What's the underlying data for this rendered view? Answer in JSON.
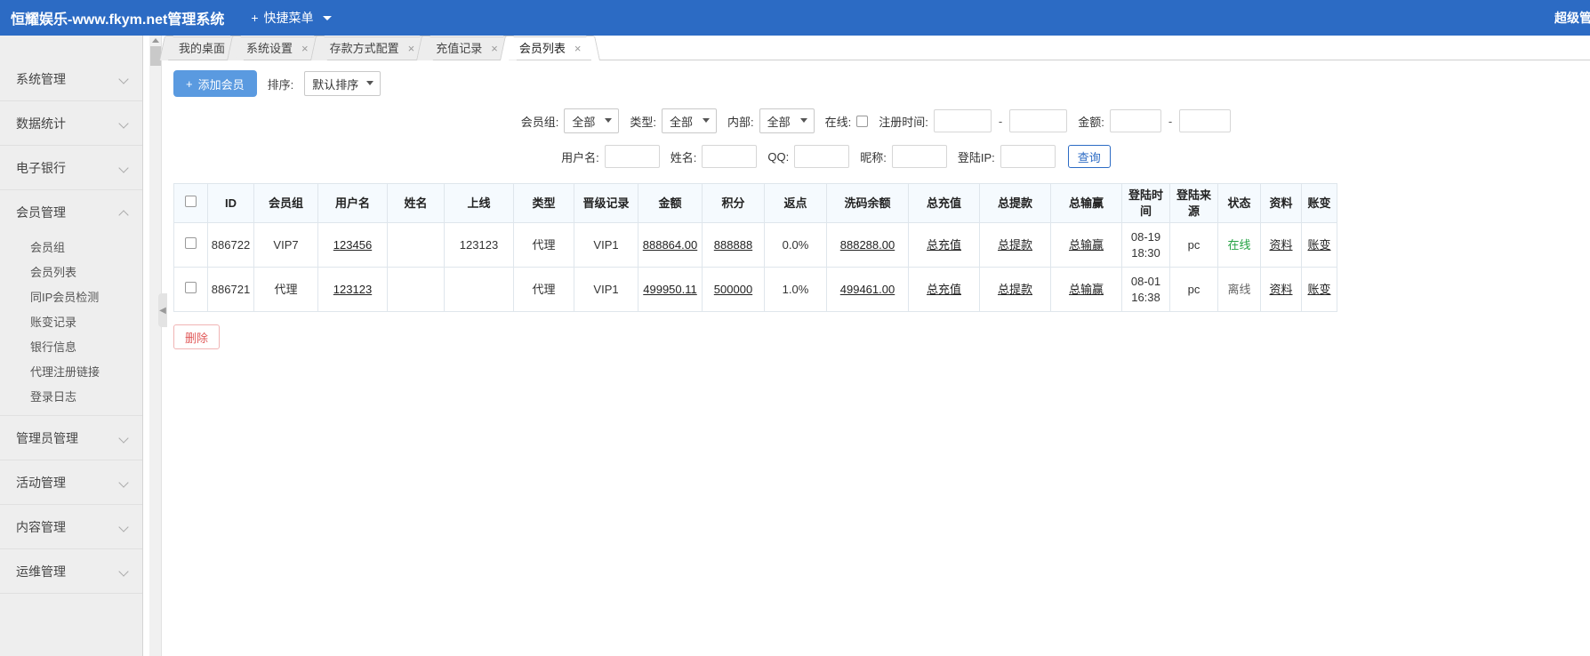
{
  "topbar": {
    "brand": "恒耀娱乐-www.fkym.net管理系统",
    "quick_menu": "快捷菜单",
    "plus": "+",
    "user": "超级管理员"
  },
  "sidebar": {
    "groups": [
      {
        "label": "系统管理",
        "expanded": false,
        "items": []
      },
      {
        "label": "数据统计",
        "expanded": false,
        "items": []
      },
      {
        "label": "电子银行",
        "expanded": false,
        "items": []
      },
      {
        "label": "会员管理",
        "expanded": true,
        "items": [
          "会员组",
          "会员列表",
          "同IP会员检测",
          "账变记录",
          "银行信息",
          "代理注册链接",
          "登录日志"
        ]
      },
      {
        "label": "管理员管理",
        "expanded": false,
        "items": []
      },
      {
        "label": "活动管理",
        "expanded": false,
        "items": []
      },
      {
        "label": "内容管理",
        "expanded": false,
        "items": []
      },
      {
        "label": "运维管理",
        "expanded": false,
        "items": []
      }
    ]
  },
  "tabs": [
    {
      "label": "我的桌面",
      "closable": false,
      "active": false
    },
    {
      "label": "系统设置",
      "closable": true,
      "active": false
    },
    {
      "label": "存款方式配置",
      "closable": true,
      "active": false
    },
    {
      "label": "充值记录",
      "closable": true,
      "active": false
    },
    {
      "label": "会员列表",
      "closable": true,
      "active": true
    }
  ],
  "toolbar": {
    "add_member": "添加会员",
    "add_icon": "+",
    "sort_label": "排序:",
    "sort_value": "默认排序"
  },
  "filters": {
    "row1": {
      "member_group_label": "会员组:",
      "member_group_value": "全部",
      "type_label": "类型:",
      "type_value": "全部",
      "internal_label": "内部:",
      "internal_value": "全部",
      "online_label": "在线:",
      "online_checked": false,
      "reg_time_label": "注册时间:",
      "reg_time_start": "",
      "reg_time_end": "",
      "amount_label": "金额:",
      "amount_min": "",
      "amount_max": "",
      "dash": "-"
    },
    "row2": {
      "username_label": "用户名:",
      "username_value": "",
      "realname_label": "姓名:",
      "realname_value": "",
      "qq_label": "QQ:",
      "qq_value": "",
      "nickname_label": "昵称:",
      "nickname_value": "",
      "login_ip_label": "登陆IP:",
      "login_ip_value": "",
      "search_button": "查询"
    }
  },
  "table": {
    "headers": [
      "",
      "ID",
      "会员组",
      "用户名",
      "姓名",
      "上线",
      "类型",
      "晋级记录",
      "金额",
      "积分",
      "返点",
      "洗码余额",
      "总充值",
      "总提款",
      "总输赢",
      "登陆时间",
      "登陆来源",
      "状态",
      "资料",
      "账变"
    ],
    "rows": [
      {
        "id": "886722",
        "group": "VIP7",
        "username": "123456",
        "realname": "",
        "upline": "123123",
        "type": "代理",
        "promote": "VIP1",
        "amount": "888864.00",
        "points": "888888",
        "rebate": "0.0%",
        "wash_balance": "888288.00",
        "total_recharge": "总充值",
        "total_withdraw": "总提款",
        "total_winloss": "总输赢",
        "login_time": "08-19 18:30",
        "login_source": "pc",
        "status": "在线",
        "profile": "资料",
        "account_change": "账变",
        "delete": "删"
      },
      {
        "id": "886721",
        "group": "代理",
        "username": "123123",
        "realname": "",
        "upline": "",
        "type": "代理",
        "promote": "VIP1",
        "amount": "499950.11",
        "points": "500000",
        "rebate": "1.0%",
        "wash_balance": "499461.00",
        "total_recharge": "总充值",
        "total_withdraw": "总提款",
        "total_winloss": "总输赢",
        "login_time": "08-01 16:38",
        "login_source": "pc",
        "status": "离线",
        "profile": "资料",
        "account_change": "账变",
        "delete": "删"
      }
    ]
  },
  "bottom": {
    "delete_button": "删除"
  },
  "colors": {
    "brand_blue": "#2c6bc4",
    "button_blue": "#5a9ae0",
    "online_green": "#25a244",
    "delete_red": "#e05a5a",
    "header_bg": "#f5fafe"
  }
}
